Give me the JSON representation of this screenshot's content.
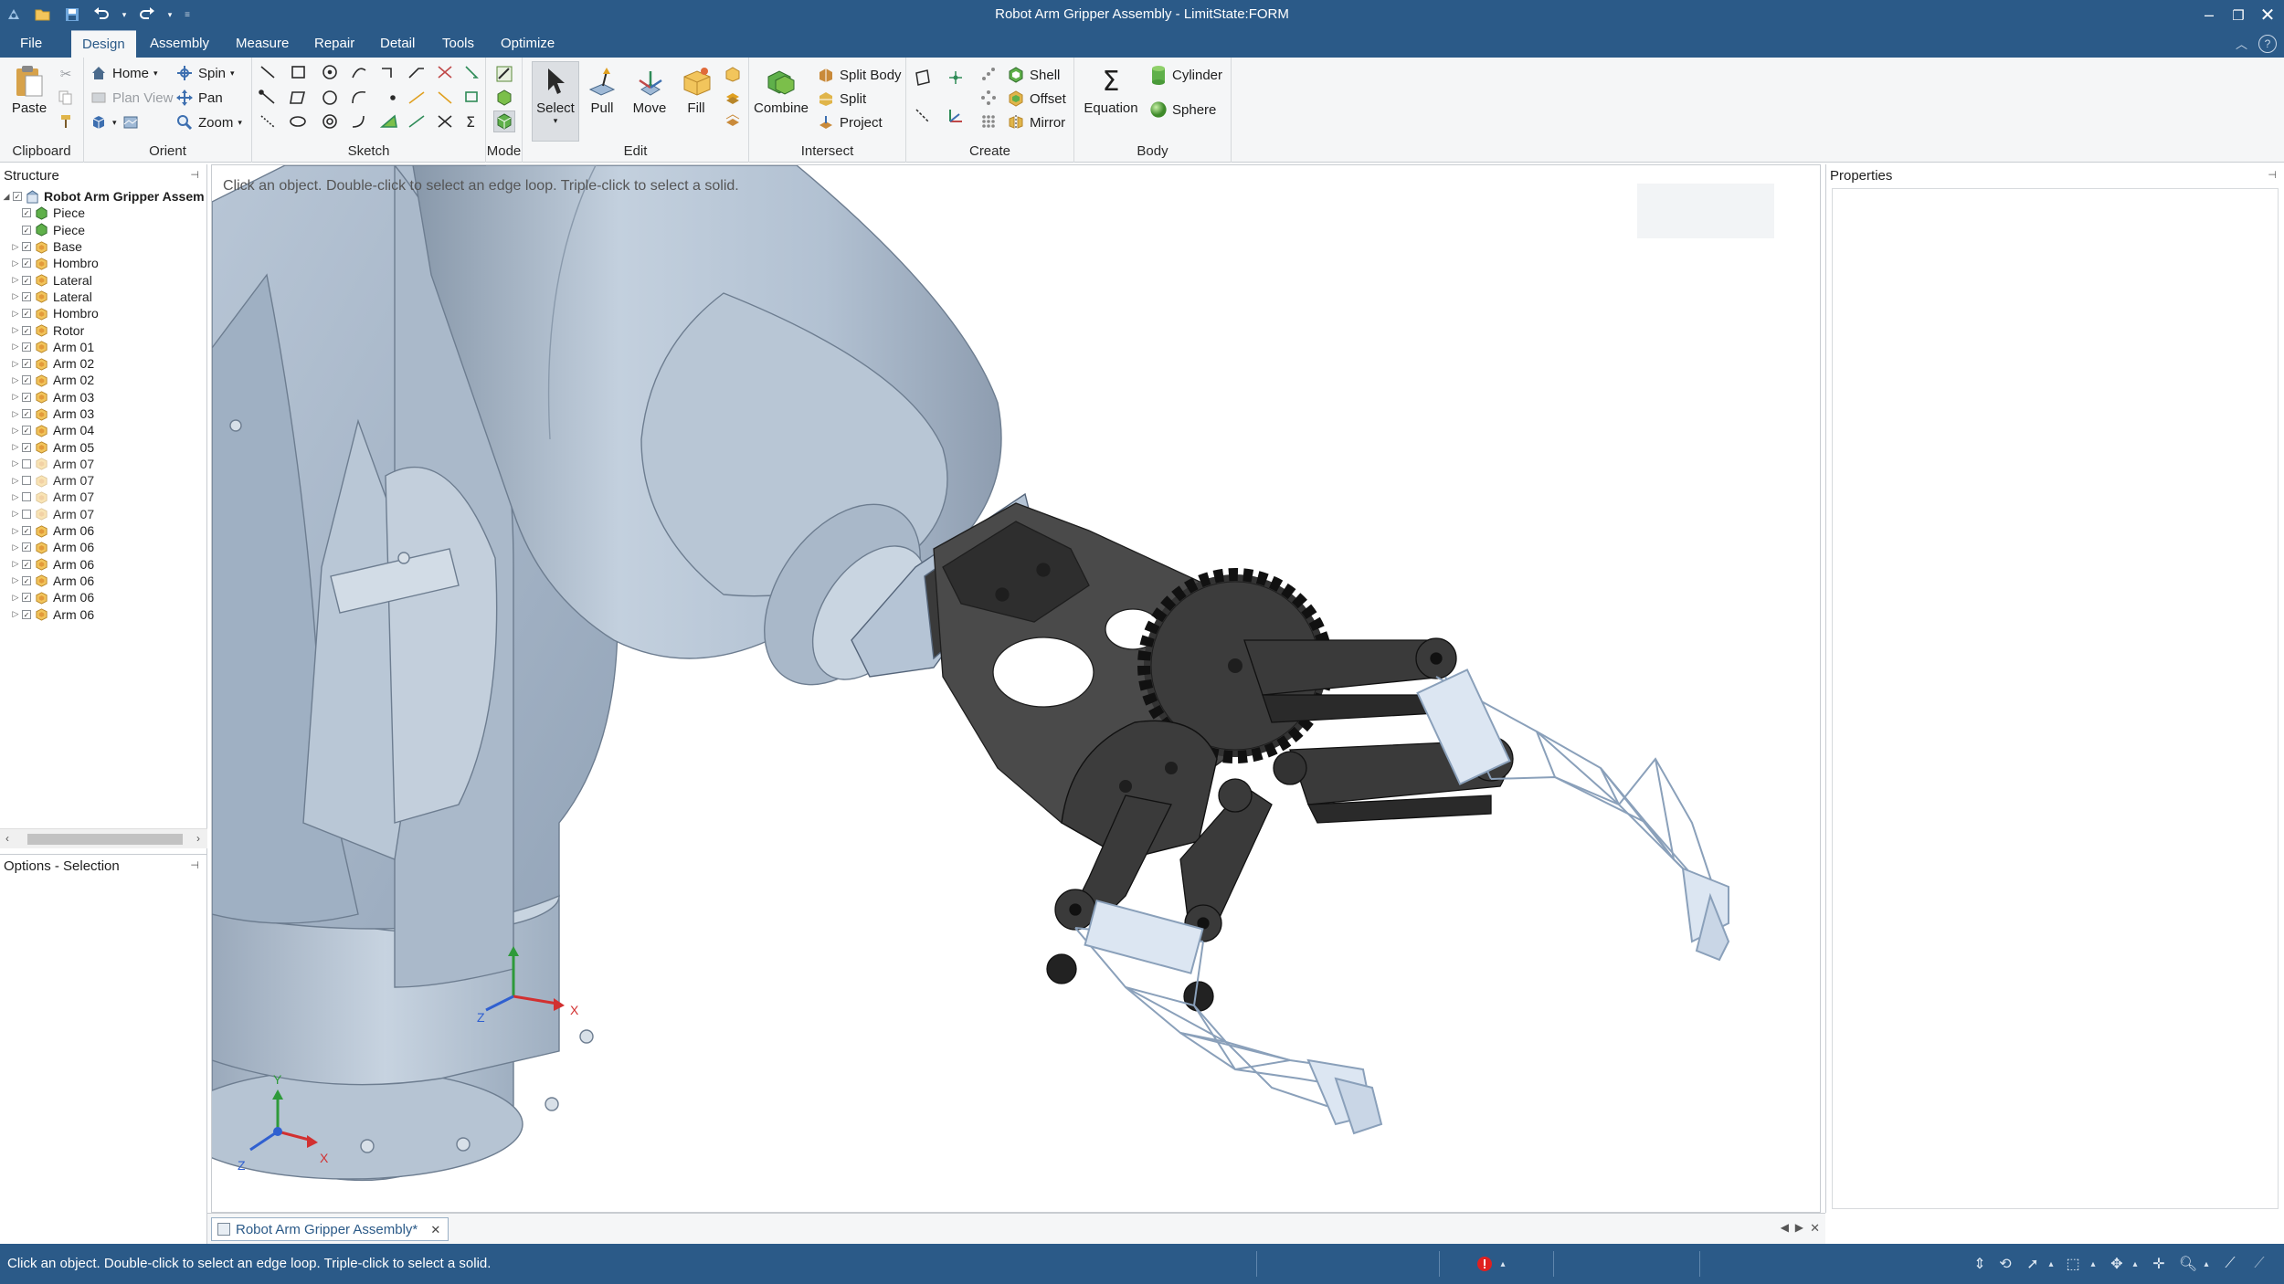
{
  "window": {
    "title": "Robot Arm Gripper Assembly - LimitState:FORM"
  },
  "quick_access": {
    "icons": [
      "app-icon",
      "open-icon",
      "save-icon",
      "undo-icon",
      "redo-icon",
      "customize-icon"
    ]
  },
  "ribbon_tabs": [
    "File",
    "Design",
    "Assembly",
    "Measure",
    "Repair",
    "Detail",
    "Tools",
    "Optimize"
  ],
  "active_tab": "Design",
  "ribbon": {
    "clipboard": {
      "label": "Clipboard",
      "paste": "Paste"
    },
    "orient": {
      "label": "Orient",
      "home": "Home",
      "plan_view": "Plan View",
      "spin": "Spin",
      "pan": "Pan",
      "zoom": "Zoom"
    },
    "sketch": {
      "label": "Sketch"
    },
    "mode": {
      "label": "Mode"
    },
    "edit": {
      "label": "Edit",
      "select": "Select",
      "pull": "Pull",
      "move": "Move",
      "fill": "Fill"
    },
    "intersect": {
      "label": "Intersect",
      "combine": "Combine",
      "split_body": "Split Body",
      "split": "Split",
      "project": "Project"
    },
    "create": {
      "label": "Create",
      "shell": "Shell",
      "offset": "Offset",
      "mirror": "Mirror"
    },
    "body": {
      "label": "Body",
      "equation": "Equation",
      "cylinder": "Cylinder",
      "sphere": "Sphere"
    }
  },
  "structure": {
    "title": "Structure",
    "root": "Robot Arm Gripper Assem",
    "items": [
      {
        "label": "Piece",
        "visible": true
      },
      {
        "label": "Piece",
        "visible": true
      },
      {
        "label": "Base",
        "visible": true
      },
      {
        "label": "Hombro",
        "visible": true
      },
      {
        "label": "Lateral",
        "visible": true
      },
      {
        "label": "Lateral",
        "visible": true
      },
      {
        "label": "Hombro",
        "visible": true
      },
      {
        "label": "Rotor",
        "visible": true
      },
      {
        "label": "Arm 01",
        "visible": true
      },
      {
        "label": "Arm 02",
        "visible": true
      },
      {
        "label": "Arm 02",
        "visible": true
      },
      {
        "label": "Arm 03",
        "visible": true
      },
      {
        "label": "Arm 03",
        "visible": true
      },
      {
        "label": "Arm 04",
        "visible": true
      },
      {
        "label": "Arm 05",
        "visible": true
      },
      {
        "label": "Arm 07",
        "visible": false
      },
      {
        "label": "Arm 07",
        "visible": false
      },
      {
        "label": "Arm 07",
        "visible": false
      },
      {
        "label": "Arm 07",
        "visible": false
      },
      {
        "label": "Arm 06",
        "visible": true
      },
      {
        "label": "Arm 06",
        "visible": true
      },
      {
        "label": "Arm 06",
        "visible": true
      },
      {
        "label": "Arm 06",
        "visible": true
      },
      {
        "label": "Arm 06",
        "visible": true
      },
      {
        "label": "Arm 06",
        "visible": true
      }
    ]
  },
  "options_panel": {
    "title": "Options - Selection"
  },
  "properties_panel": {
    "title": "Properties"
  },
  "viewport": {
    "hint": "Click an object. Double-click to select an edge loop. Triple-click to select a solid.",
    "axis_labels": {
      "x": "X",
      "y": "Y",
      "z": "Z"
    }
  },
  "document_tab": {
    "label": "Robot Arm Gripper Assembly*"
  },
  "status": {
    "message": "Click an object. Double-click to select an edge loop. Triple-click to select a solid."
  },
  "colors": {
    "chrome": "#2b5a88",
    "ribbon_bg": "#f5f6f7",
    "part_blue": "#b4c3d4",
    "gripper_dark": "#3a3a3a",
    "lattice": "#dce6f2"
  }
}
